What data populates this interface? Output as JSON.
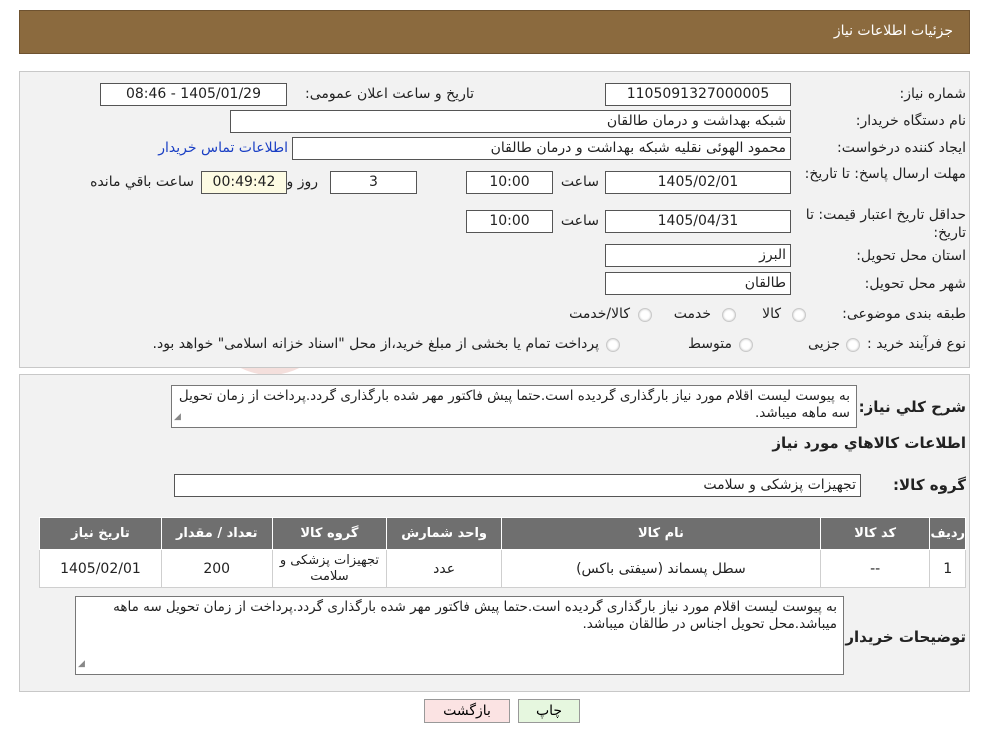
{
  "header": {
    "title": "جزئیات اطلاعات نیاز"
  },
  "form": {
    "need_number_label": "شماره نیاز:",
    "need_number": "1105091327000005",
    "announce_label": "تاریخ و ساعت اعلان عمومی:",
    "announce_value": "1405/01/29 - 08:46",
    "buyer_org_label": "نام دستگاه خریدار:",
    "buyer_org": "شبکه بهداشت و درمان طالقان",
    "creator_label": "ایجاد کننده درخواست:",
    "creator": "محمود الهوئی نقلیه شبکه بهداشت و درمان طالقان",
    "contact_link": "اطلاعات تماس خریدار",
    "deadline_label": "مهلت ارسال پاسخ: تا تاریخ:",
    "deadline_date": "1405/02/01",
    "time_label": "ساعت",
    "deadline_time": "10:00",
    "days_value": "3",
    "days_label": "روز و",
    "remaining_time": "00:49:42",
    "remaining_label": "ساعت باقي مانده",
    "validity_label": "حداقل تاریخ اعتبار قیمت: تا تاریخ:",
    "validity_date": "1405/04/31",
    "validity_time": "10:00",
    "province_label": "استان محل تحویل:",
    "province": "البرز",
    "city_label": "شهر محل تحویل:",
    "city": "طالقان",
    "category_label": "طبقه بندی موضوعی:",
    "category_options": [
      "کالا",
      "خدمت",
      "کالا/خدمت"
    ],
    "purchase_type_label": "نوع فرآیند خرید :",
    "purchase_options": [
      "جزیی",
      "متوسط"
    ],
    "purchase_note": "پرداخت تمام یا بخشی از مبلغ خرید،از محل \"اسناد خزانه اسلامی\" خواهد بود."
  },
  "description": {
    "label": "شرح کلي نياز:",
    "text": "به پیوست لیست اقلام مورد نیاز بارگذاری گردیده است.حتما پیش فاکتور مهر شده بارگذاری گردد.پرداخت از زمان تحویل سه ماهه میباشد."
  },
  "goods": {
    "section_title": "اطلاعات کالاهاي مورد نياز",
    "group_label": "گروه کالا:",
    "group_value": "تجهیزات پزشکی و سلامت",
    "columns": [
      "ردیف",
      "کد کالا",
      "نام کالا",
      "واحد شمارش",
      "گروه کالا",
      "تعداد / مقدار",
      "تاریخ نیاز"
    ],
    "rows": [
      [
        "1",
        "--",
        "سطل پسماند (سیفتی باکس)",
        "عدد",
        "تجهیزات پزشکی و سلامت",
        "200",
        "1405/02/01"
      ]
    ]
  },
  "buyer_notes": {
    "label": "توضیحات خریدار:",
    "text": "به پیوست لیست اقلام مورد نیاز بارگذاری گردیده است.حتما پیش فاکتور مهر شده بارگذاری گردد.پرداخت از زمان تحویل سه ماهه میباشد.محل تحویل اجناس در طالقان میباشد."
  },
  "buttons": {
    "print": "چاپ",
    "back": "بازگشت"
  },
  "watermark": {
    "text": "AriaTender.neT"
  },
  "colors": {
    "header_bg": "#8b6a3e",
    "table_header_bg": "#6f6f6f",
    "link": "#1a3fc4",
    "back_btn_bg": "#fbe3e3",
    "print_btn_bg": "#e6f7df"
  }
}
